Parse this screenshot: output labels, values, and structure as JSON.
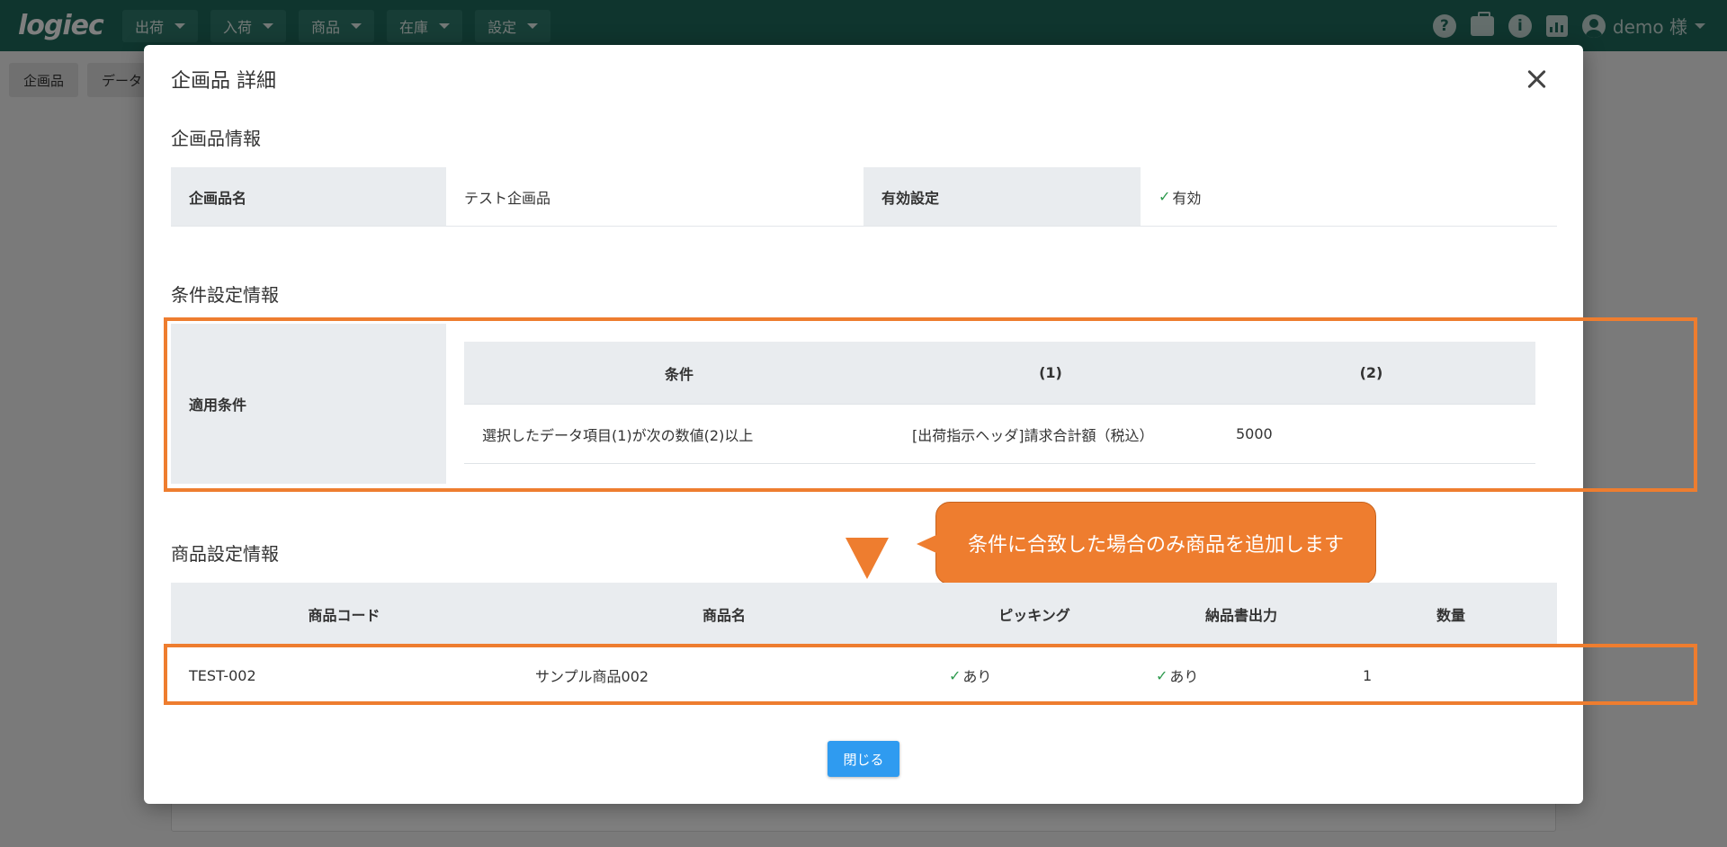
{
  "app": {
    "logo": "logiec"
  },
  "nav": {
    "items": [
      "出荷",
      "入荷",
      "商品",
      "在庫",
      "設定"
    ],
    "user": "demo 様"
  },
  "crumbs": [
    "企画品",
    "データ"
  ],
  "modal": {
    "title": "企画品 詳細",
    "product_info_title": "企画品情報",
    "product_name_label": "企画品名",
    "product_name_value": "テスト企画品",
    "valid_label": "有効設定",
    "valid_value": "有効",
    "cond_title": "条件設定情報",
    "cond_label": "適用条件",
    "cond_headers": [
      "条件",
      "(1)",
      "(2)"
    ],
    "cond_row": [
      "選択したデータ項目(1)が次の数値(2)以上",
      "[出荷指示ヘッダ]請求合計額（税込）",
      "5000"
    ],
    "goods_title": "商品設定情報",
    "goods_headers": [
      "商品コード",
      "商品名",
      "ピッキング",
      "納品書出力",
      "数量"
    ],
    "goods_row": [
      "TEST-002",
      "サンプル商品002",
      "あり",
      "あり",
      "1"
    ],
    "callout": "条件に合致した場合のみ商品を追加します",
    "close_button": "閉じる"
  },
  "colors": {
    "header": "#1f6b5d",
    "accent": "#ee7d2f",
    "button": "#2f9bf0"
  }
}
